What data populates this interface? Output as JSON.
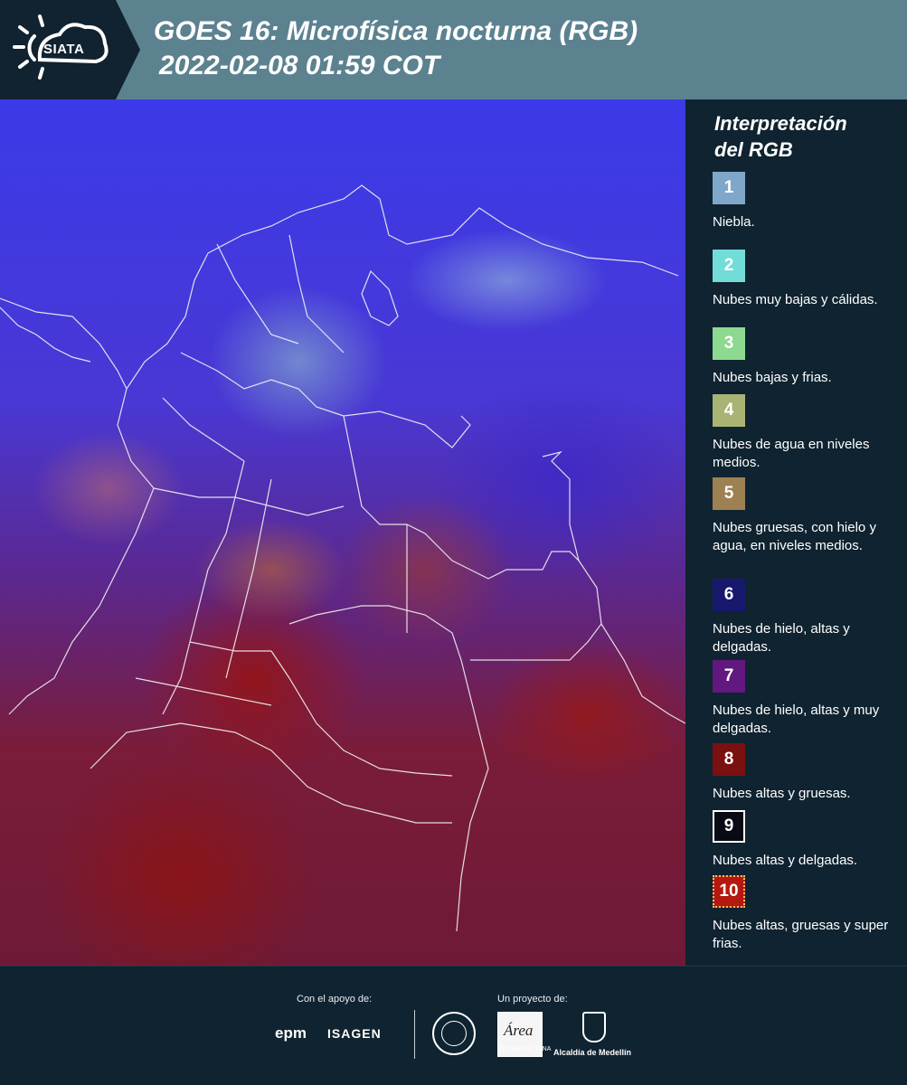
{
  "header": {
    "logo_text": "SIATA",
    "title_line1": "GOES 16: Microfísica nocturna (RGB)",
    "title_line2": "2022-02-08 01:59 COT"
  },
  "legend": {
    "title_line1": "Interpretación",
    "title_line2": "del RGB",
    "items": [
      {
        "num": "1",
        "color": "#7fa7c9",
        "label": "Niebla."
      },
      {
        "num": "2",
        "color": "#72dcd6",
        "label": "Nubes muy bajas y cálidas."
      },
      {
        "num": "3",
        "color": "#8dd98f",
        "label": "Nubes bajas y frias."
      },
      {
        "num": "4",
        "color": "#a9b374",
        "label": "Nubes de agua en niveles medios."
      },
      {
        "num": "5",
        "color": "#9e8151",
        "label": "Nubes gruesas, con hielo y agua, en niveles medios."
      },
      {
        "num": "6",
        "color": "#17186e",
        "label": "Nubes de hielo, altas y delgadas."
      },
      {
        "num": "7",
        "color": "#62187e",
        "label": "Nubes de hielo, altas y muy delgadas."
      },
      {
        "num": "8",
        "color": "#7a1010",
        "label": "Nubes altas y gruesas."
      },
      {
        "num": "9",
        "color": "#0a0a14",
        "label": "Nubes altas y delgadas."
      },
      {
        "num": "10",
        "color": "#b5180e",
        "label": "Nubes altas, gruesas y super frias."
      }
    ]
  },
  "footer": {
    "support_label": "Con el apoyo de:",
    "project_label": "Un proyecto de:",
    "epm": "epm",
    "isagen": "ISAGEN",
    "area_logo": "Área",
    "area_text": "METROPOLITANA",
    "alcaldia": "Alcaldía de Medellín"
  }
}
